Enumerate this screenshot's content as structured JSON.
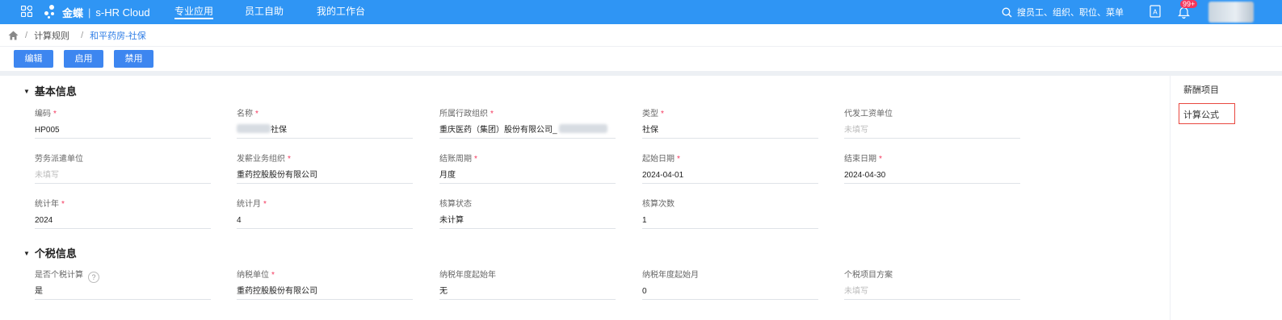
{
  "app": {
    "brand": "金蝶",
    "product": "s-HR Cloud",
    "nav": [
      "专业应用",
      "员工自助",
      "我的工作台"
    ],
    "active_nav": "专业应用",
    "search_placeholder": "搜员工、组织、职位、菜单",
    "notification_count": "99+",
    "accent_color": "#2f95f4"
  },
  "breadcrumb": {
    "items": [
      "计算规则",
      "和平药房-社保"
    ]
  },
  "toolbar": {
    "edit": "编辑",
    "enable": "启用",
    "disable": "禁用"
  },
  "sections": {
    "basic": {
      "title": "基本信息"
    },
    "tax": {
      "title": "个税信息"
    }
  },
  "basic_fields": {
    "code": {
      "label": "编码",
      "value": "HP005"
    },
    "name": {
      "label": "名称",
      "value": "社保"
    },
    "admin_org": {
      "label": "所属行政组织",
      "value": "重庆医药（集团）股份有限公司_"
    },
    "type": {
      "label": "类型",
      "value": "社保"
    },
    "agent_pay_unit": {
      "label": "代发工资单位",
      "value": "未填写"
    },
    "labor_dispatch_unit": {
      "label": "劳务派遣单位",
      "value": "未填写"
    },
    "pay_business_org": {
      "label": "发薪业务组织",
      "value": "重药控股股份有限公司"
    },
    "settle_period": {
      "label": "结账周期",
      "value": "月度"
    },
    "start_date": {
      "label": "起始日期",
      "value": "2024-04-01"
    },
    "end_date": {
      "label": "结束日期",
      "value": "2024-04-30"
    },
    "stat_year": {
      "label": "统计年",
      "value": "2024"
    },
    "stat_month": {
      "label": "统计月",
      "value": "4"
    },
    "calc_status": {
      "label": "核算状态",
      "value": "未计算"
    },
    "calc_count": {
      "label": "核算次数",
      "value": "1"
    }
  },
  "tax_fields": {
    "is_tax_calc": {
      "label": "是否个税计算",
      "value": "是"
    },
    "tax_unit": {
      "label": "纳税单位",
      "value": "重药控股股份有限公司"
    },
    "tax_year_start_year": {
      "label": "纳税年度起始年",
      "value": "无"
    },
    "tax_year_start_month": {
      "label": "纳税年度起始月",
      "value": "0"
    },
    "tax_item_scheme": {
      "label": "个税项目方案",
      "value": "未填写"
    }
  },
  "right_panel": {
    "items": [
      "薪酬项目",
      "计算公式"
    ],
    "highlighted": "计算公式"
  }
}
